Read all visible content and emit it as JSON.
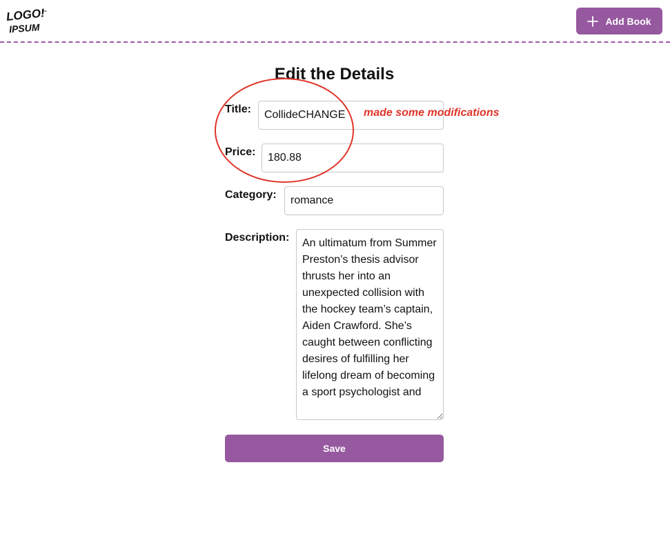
{
  "header": {
    "logo_text_top": "LOGO!",
    "logo_text_bottom": "IPSUM",
    "logo_tm": "™",
    "add_button_label": "Add Book",
    "add_button_icon": "plus-icon",
    "accent_color": "#96599f"
  },
  "form": {
    "title": "Edit the Details",
    "fields": {
      "title": {
        "label": "Title:",
        "value": "CollideCHANGE"
      },
      "price": {
        "label": "Price:",
        "value": "180.88"
      },
      "category": {
        "label": "Category:",
        "value": "romance"
      },
      "description": {
        "label": "Description:",
        "value": "An ultimatum from Summer Preston’s thesis advisor thrusts her into an unexpected collision with the hockey team’s captain, Aiden Crawford. She’s caught between conflicting desires of fulfilling her lifelong dream of becoming a sport psychologist and"
      }
    },
    "save_label": "Save"
  },
  "annotation": {
    "note": "made some modifications",
    "color": "#e03428"
  }
}
